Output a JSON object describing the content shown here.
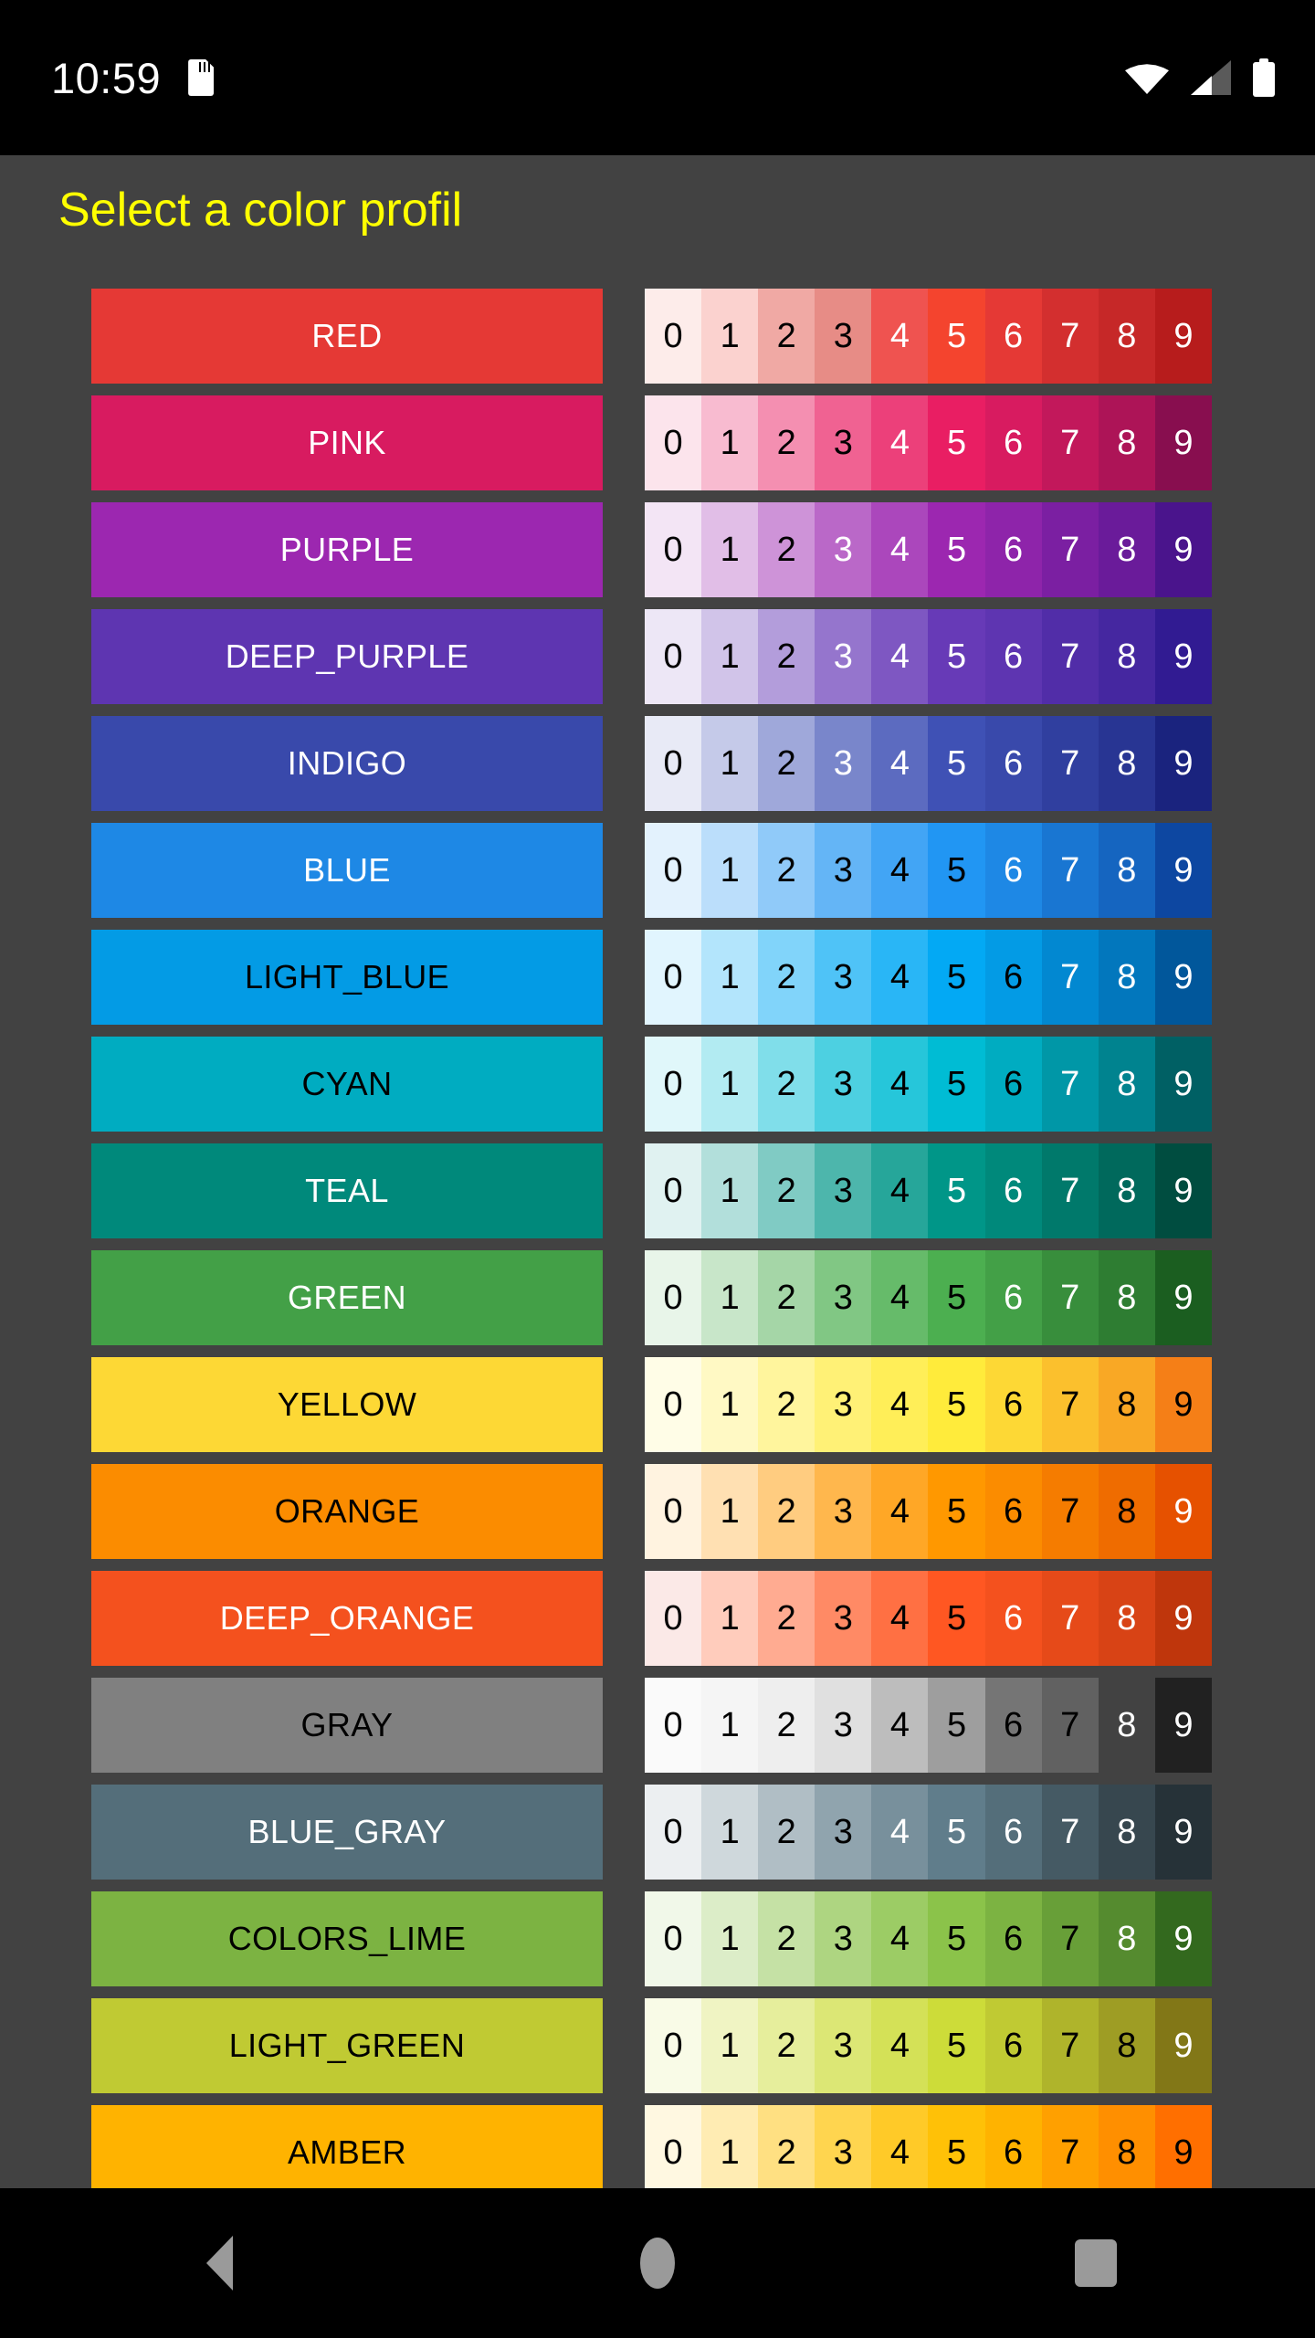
{
  "status_bar": {
    "time": "10:59",
    "icons": [
      "sdcard-icon",
      "wifi-icon",
      "signal-icon",
      "battery-icon"
    ]
  },
  "header": {
    "title": "Select a color profil",
    "title_color": "#ffff00"
  },
  "theme": {
    "background": "#424242",
    "status_bar_background": "#000000",
    "nav_bar_background": "#000000",
    "nav_icon_color": "#9a9a9a"
  },
  "swatch_digits": [
    "0",
    "1",
    "2",
    "3",
    "4",
    "5",
    "6",
    "7",
    "8",
    "9"
  ],
  "nav_bar": {
    "buttons": [
      {
        "name": "back-button",
        "icon": "triangle-left-icon"
      },
      {
        "name": "home-button",
        "icon": "circle-icon"
      },
      {
        "name": "recents-button",
        "icon": "square-icon"
      }
    ]
  },
  "rows": [
    {
      "label": "RED",
      "label_color": "#ffffff",
      "button_color": "#e53935",
      "shades": [
        "#fdecea",
        "#fbd2cf",
        "#f0a9a4",
        "#e78c86",
        "#ef5350",
        "#f4442e",
        "#e53935",
        "#d32f2f",
        "#c62828",
        "#b71c1c"
      ],
      "digit_colors": [
        "#000000",
        "#000000",
        "#000000",
        "#000000",
        "#ffffff",
        "#ffffff",
        "#ffffff",
        "#ffffff",
        "#ffffff",
        "#ffffff"
      ]
    },
    {
      "label": "PINK",
      "label_color": "#ffffff",
      "button_color": "#d81b60",
      "shades": [
        "#fce4ec",
        "#f8bbd0",
        "#f48fb1",
        "#f06292",
        "#ec407a",
        "#e91e63",
        "#d81b60",
        "#c2185b",
        "#ad1457",
        "#880e4f"
      ],
      "digit_colors": [
        "#000000",
        "#000000",
        "#000000",
        "#000000",
        "#ffffff",
        "#ffffff",
        "#ffffff",
        "#ffffff",
        "#ffffff",
        "#ffffff"
      ]
    },
    {
      "label": "PURPLE",
      "label_color": "#ffffff",
      "button_color": "#9c27b0",
      "shades": [
        "#f3e5f5",
        "#e1bee7",
        "#ce93d8",
        "#ba68c8",
        "#ab47bc",
        "#9c27b0",
        "#8e24aa",
        "#7b1fa2",
        "#6a1b9a",
        "#4a148c"
      ],
      "digit_colors": [
        "#000000",
        "#000000",
        "#000000",
        "#ffffff",
        "#ffffff",
        "#ffffff",
        "#ffffff",
        "#ffffff",
        "#ffffff",
        "#ffffff"
      ]
    },
    {
      "label": "DEEP_PURPLE",
      "label_color": "#ffffff",
      "button_color": "#5e35b1",
      "shades": [
        "#ede7f6",
        "#d1c4e9",
        "#b39ddb",
        "#9575cd",
        "#7e57c2",
        "#673ab7",
        "#5e35b1",
        "#512da8",
        "#4527a0",
        "#311b92"
      ],
      "digit_colors": [
        "#000000",
        "#000000",
        "#000000",
        "#ffffff",
        "#ffffff",
        "#ffffff",
        "#ffffff",
        "#ffffff",
        "#ffffff",
        "#ffffff"
      ]
    },
    {
      "label": "INDIGO",
      "label_color": "#ffffff",
      "button_color": "#3949ab",
      "shades": [
        "#e8eaf6",
        "#c5cae9",
        "#9fa8da",
        "#7986cb",
        "#5c6bc0",
        "#3f51b5",
        "#3949ab",
        "#303f9f",
        "#283593",
        "#1a237e"
      ],
      "digit_colors": [
        "#000000",
        "#000000",
        "#000000",
        "#ffffff",
        "#ffffff",
        "#ffffff",
        "#ffffff",
        "#ffffff",
        "#ffffff",
        "#ffffff"
      ]
    },
    {
      "label": "BLUE",
      "label_color": "#ffffff",
      "button_color": "#1e88e5",
      "shades": [
        "#e3f2fd",
        "#bbdefb",
        "#90caf9",
        "#64b5f6",
        "#42a5f5",
        "#2196f3",
        "#1e88e5",
        "#1976d2",
        "#1565c0",
        "#0d47a1"
      ],
      "digit_colors": [
        "#000000",
        "#000000",
        "#000000",
        "#000000",
        "#000000",
        "#000000",
        "#ffffff",
        "#ffffff",
        "#ffffff",
        "#ffffff"
      ]
    },
    {
      "label": "LIGHT_BLUE",
      "label_color": "#000000",
      "button_color": "#039be5",
      "shades": [
        "#e1f5fe",
        "#b3e5fc",
        "#81d4fa",
        "#4fc3f7",
        "#29b6f6",
        "#03a9f4",
        "#039be5",
        "#0288d1",
        "#0277bd",
        "#01579b"
      ],
      "digit_colors": [
        "#000000",
        "#000000",
        "#000000",
        "#000000",
        "#000000",
        "#000000",
        "#000000",
        "#ffffff",
        "#ffffff",
        "#ffffff"
      ]
    },
    {
      "label": "CYAN",
      "label_color": "#000000",
      "button_color": "#00acc1",
      "shades": [
        "#e0f7fa",
        "#b2ebf2",
        "#80deea",
        "#4dd0e1",
        "#26c6da",
        "#00bcd4",
        "#00acc1",
        "#0097a7",
        "#00838f",
        "#006064"
      ],
      "digit_colors": [
        "#000000",
        "#000000",
        "#000000",
        "#000000",
        "#000000",
        "#000000",
        "#000000",
        "#ffffff",
        "#ffffff",
        "#ffffff"
      ]
    },
    {
      "label": "TEAL",
      "label_color": "#ffffff",
      "button_color": "#00897b",
      "shades": [
        "#e0f2f1",
        "#b2dfdb",
        "#80cbc4",
        "#4db6ac",
        "#26a69a",
        "#009688",
        "#00897b",
        "#00796b",
        "#00695c",
        "#004d40"
      ],
      "digit_colors": [
        "#000000",
        "#000000",
        "#000000",
        "#000000",
        "#000000",
        "#ffffff",
        "#ffffff",
        "#ffffff",
        "#ffffff",
        "#ffffff"
      ]
    },
    {
      "label": "GREEN",
      "label_color": "#ffffff",
      "button_color": "#43a047",
      "shades": [
        "#e8f5e9",
        "#c8e6c9",
        "#a5d6a7",
        "#81c784",
        "#66bb6a",
        "#4caf50",
        "#43a047",
        "#388e3c",
        "#2e7d32",
        "#1b5e20"
      ],
      "digit_colors": [
        "#000000",
        "#000000",
        "#000000",
        "#000000",
        "#000000",
        "#000000",
        "#ffffff",
        "#ffffff",
        "#ffffff",
        "#ffffff"
      ]
    },
    {
      "label": "YELLOW",
      "label_color": "#000000",
      "button_color": "#fdd835",
      "shades": [
        "#fffde7",
        "#fff9c4",
        "#fff59d",
        "#fff176",
        "#ffee58",
        "#ffeb3b",
        "#fdd835",
        "#fbc02d",
        "#f9a825",
        "#f57f17"
      ],
      "digit_colors": [
        "#000000",
        "#000000",
        "#000000",
        "#000000",
        "#000000",
        "#000000",
        "#000000",
        "#000000",
        "#000000",
        "#000000"
      ]
    },
    {
      "label": "ORANGE",
      "label_color": "#000000",
      "button_color": "#fb8c00",
      "shades": [
        "#fff3e0",
        "#ffe0b2",
        "#ffcc80",
        "#ffb74d",
        "#ffa726",
        "#ff9800",
        "#fb8c00",
        "#f57c00",
        "#ef6c00",
        "#e65100"
      ],
      "digit_colors": [
        "#000000",
        "#000000",
        "#000000",
        "#000000",
        "#000000",
        "#000000",
        "#000000",
        "#000000",
        "#000000",
        "#ffffff"
      ]
    },
    {
      "label": "DEEP_ORANGE",
      "label_color": "#ffffff",
      "button_color": "#f4511e",
      "shades": [
        "#fbe9e7",
        "#ffccbc",
        "#ffab91",
        "#ff8a65",
        "#ff7043",
        "#ff5722",
        "#f4511e",
        "#e64a19",
        "#d84315",
        "#bf360c"
      ],
      "digit_colors": [
        "#000000",
        "#000000",
        "#000000",
        "#000000",
        "#000000",
        "#000000",
        "#ffffff",
        "#ffffff",
        "#ffffff",
        "#ffffff"
      ]
    },
    {
      "label": "GRAY",
      "label_color": "#000000",
      "button_color": "#808080",
      "shades": [
        "#fafafa",
        "#f5f5f5",
        "#eeeeee",
        "#e0e0e0",
        "#bdbdbd",
        "#9e9e9e",
        "#757575",
        "#616161",
        "#424242",
        "#212121"
      ],
      "digit_colors": [
        "#000000",
        "#000000",
        "#000000",
        "#000000",
        "#000000",
        "#000000",
        "#000000",
        "#000000",
        "#ffffff",
        "#ffffff"
      ]
    },
    {
      "label": "BLUE_GRAY",
      "label_color": "#ffffff",
      "button_color": "#546e7a",
      "shades": [
        "#eceff1",
        "#cfd8dc",
        "#b0bec5",
        "#90a4ae",
        "#78909c",
        "#607d8b",
        "#546e7a",
        "#455a64",
        "#37474f",
        "#263238"
      ],
      "digit_colors": [
        "#000000",
        "#000000",
        "#000000",
        "#000000",
        "#ffffff",
        "#ffffff",
        "#ffffff",
        "#ffffff",
        "#ffffff",
        "#ffffff"
      ]
    },
    {
      "label": "COLORS_LIME",
      "label_color": "#000000",
      "button_color": "#7cb342",
      "shades": [
        "#f1f8e9",
        "#dcedc8",
        "#c5e1a5",
        "#aed581",
        "#9ccc65",
        "#8bc34a",
        "#7cb342",
        "#689f38",
        "#558b2f",
        "#33691e"
      ],
      "digit_colors": [
        "#000000",
        "#000000",
        "#000000",
        "#000000",
        "#000000",
        "#000000",
        "#000000",
        "#000000",
        "#ffffff",
        "#ffffff"
      ]
    },
    {
      "label": "LIGHT_GREEN",
      "label_color": "#000000",
      "button_color": "#c0ca33",
      "shades": [
        "#f9fbe7",
        "#f0f4c3",
        "#e6ee9c",
        "#dce775",
        "#d4e157",
        "#cddc39",
        "#c0ca33",
        "#afb42b",
        "#9e9d24",
        "#827717"
      ],
      "digit_colors": [
        "#000000",
        "#000000",
        "#000000",
        "#000000",
        "#000000",
        "#000000",
        "#000000",
        "#000000",
        "#000000",
        "#ffffff"
      ]
    },
    {
      "label": "AMBER",
      "label_color": "#000000",
      "button_color": "#ffb300",
      "shades": [
        "#fff8e1",
        "#ffecb3",
        "#ffe082",
        "#ffd54f",
        "#ffca28",
        "#ffc107",
        "#ffb300",
        "#ffa000",
        "#ff8f00",
        "#ff6f00"
      ],
      "digit_colors": [
        "#000000",
        "#000000",
        "#000000",
        "#000000",
        "#000000",
        "#000000",
        "#000000",
        "#000000",
        "#000000",
        "#000000"
      ]
    }
  ]
}
